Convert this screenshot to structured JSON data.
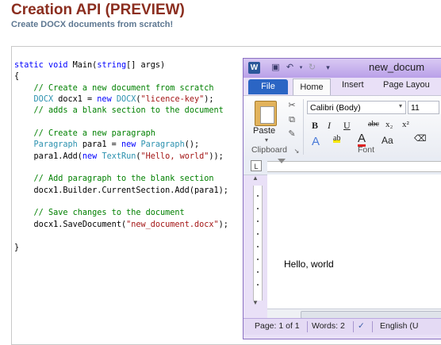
{
  "header": {
    "title": "Creation API (PREVIEW)",
    "subtitle": "Create DOCX documents from scratch!"
  },
  "code": {
    "method_signature": {
      "kw1": "static",
      "kw2": "void",
      "rest1": " Main(",
      "kw3": "string",
      "rest2": "[] args)"
    },
    "open_brace": "{",
    "comment1": "// Create a new document from scratch",
    "line_docx": {
      "type1": "DOCX",
      "mid1": " docx1 = ",
      "kw": "new",
      "mid2": " ",
      "type2": "DOCX",
      "mid3": "(",
      "str": "\"licence-key\"",
      "end": ");"
    },
    "comment2": "// adds a blank section to the document",
    "comment3": "// Create a new paragraph",
    "line_para": {
      "type1": "Paragraph",
      "mid1": " para1 = ",
      "kw": "new",
      "mid2": " ",
      "type2": "Paragraph",
      "end": "();"
    },
    "line_add": {
      "start": "para1.Add(",
      "kw": "new",
      "mid": " ",
      "type": "TextRun",
      "open": "(",
      "str": "\"Hello, world\"",
      "end": "));"
    },
    "comment4": "// Add paragraph to the blank section",
    "line_section": "docx1.Builder.CurrentSection.Add(para1);",
    "comment5": "// Save changes to the document",
    "line_save": {
      "start": "docx1.SaveDocument(",
      "str": "\"new_document.docx\"",
      "end": ");"
    },
    "close_brace": "}"
  },
  "word": {
    "logo": "W",
    "doc_title": "new_docum",
    "tabs": {
      "file": "File",
      "home": "Home",
      "insert": "Insert",
      "page_layout": "Page Layou"
    },
    "clipboard": {
      "paste_label": "Paste",
      "group_label": "Clipboard"
    },
    "font": {
      "name": "Calibri (Body)",
      "size": "11",
      "group_label": "Font",
      "bold": "B",
      "italic": "I",
      "underline": "U",
      "strike": "abc",
      "subscript": "x₂",
      "superscript": "x²",
      "text_effects": "A",
      "highlight": "ab",
      "font_color": "A",
      "change_case": "Aa"
    },
    "document_text": "Hello, world",
    "status": {
      "page": "Page: 1 of 1",
      "words": "Words: 2",
      "language": "English (U"
    }
  }
}
